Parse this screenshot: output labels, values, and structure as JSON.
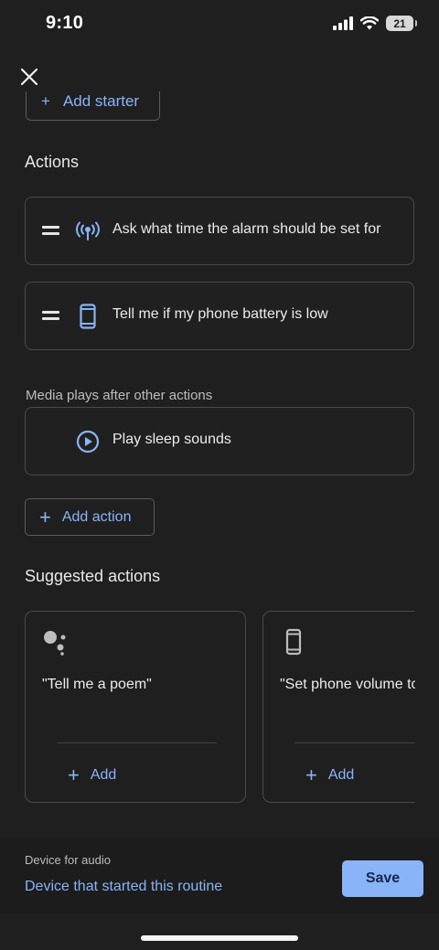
{
  "status_bar": {
    "time": "9:10",
    "battery_level": "21"
  },
  "starter": {
    "partial_label": "Add starter"
  },
  "actions": {
    "heading": "Actions",
    "items": [
      {
        "icon": "broadcast-icon",
        "label": "Ask what time the alarm should be set for"
      },
      {
        "icon": "phone-icon",
        "label": "Tell me if my phone battery is low"
      }
    ]
  },
  "media": {
    "note": "Media plays after other actions",
    "item": {
      "icon": "play-circle-icon",
      "label": "Play sleep sounds"
    }
  },
  "add_action_label": "Add action",
  "suggested": {
    "heading": "Suggested actions",
    "cards": [
      {
        "icon": "google-assistant-icon",
        "text": "\"Tell me a poem\"",
        "add_label": "Add"
      },
      {
        "icon": "phone-icon",
        "text": "\"Set phone volume to",
        "add_label": "Add"
      }
    ]
  },
  "footer": {
    "device_label": "Device for audio",
    "device_value": "Device that started this routine",
    "save_label": "Save"
  },
  "colors": {
    "accent": "#8ab4f8",
    "background": "#1f1f1f",
    "border": "#4a4a4a"
  }
}
